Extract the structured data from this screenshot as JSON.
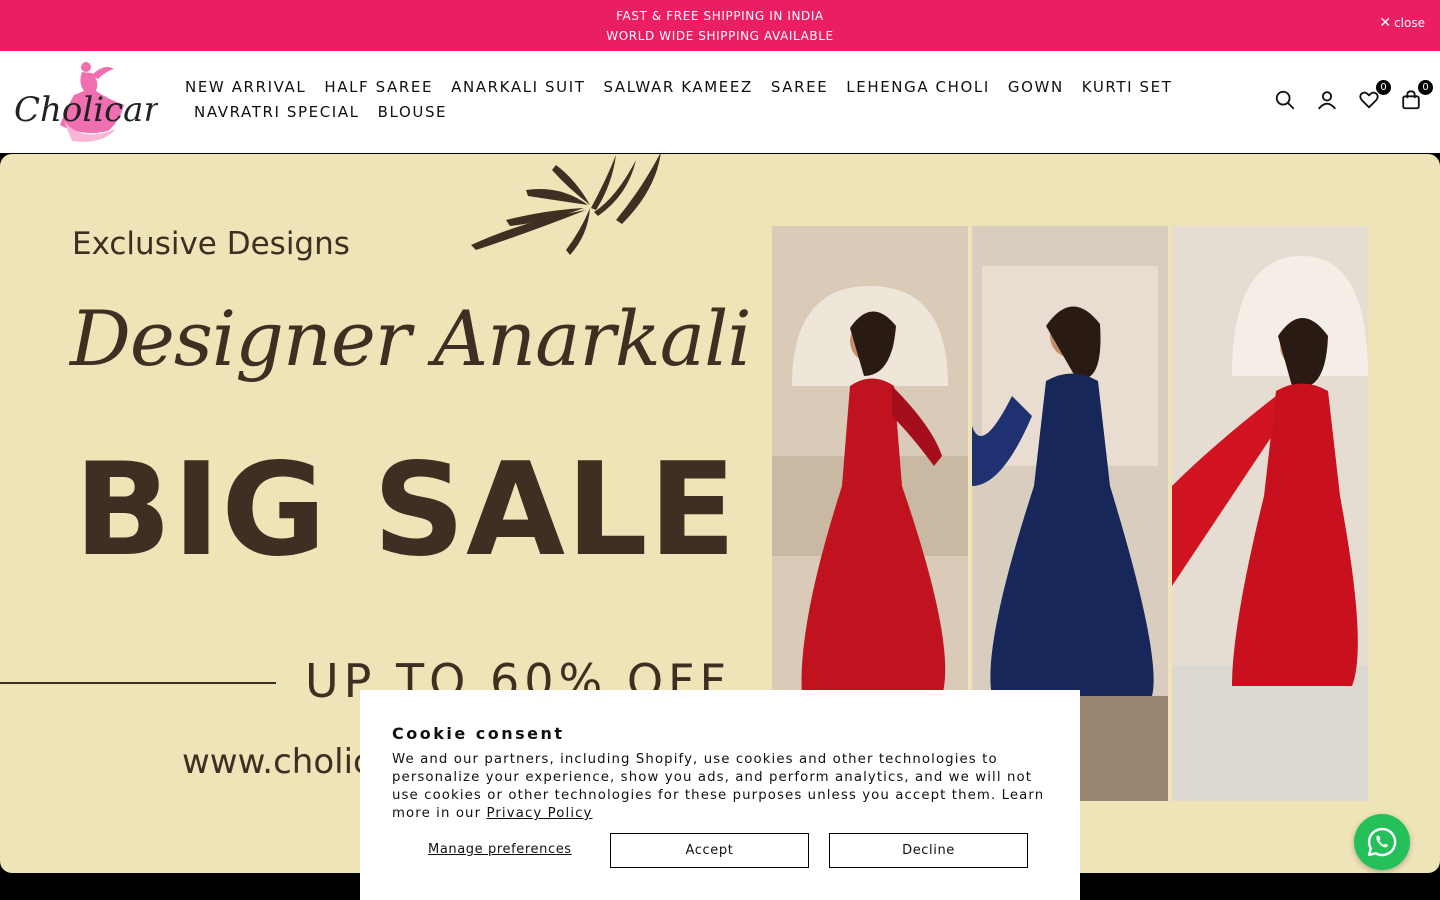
{
  "announcement": {
    "line1": "FAST & FREE SHIPPING IN INDIA",
    "line2": "WORLD WIDE SHIPPING AVAILABLE",
    "close_label": "close"
  },
  "header": {
    "logo_text": "Cholicart",
    "nav_row1": [
      "NEW ARRIVAL",
      "HALF SAREE",
      "ANARKALI SUIT",
      "SALWAR KAMEEZ",
      "SAREE",
      "LEHENGA CHOLI",
      "GOWN",
      "KURTI SET"
    ],
    "nav_row2": [
      "NAVRATRI SPECIAL",
      "BLOUSE"
    ],
    "icons": [
      "search-icon",
      "account-icon",
      "wishlist-icon",
      "cart-icon"
    ],
    "wishlist_count": "0",
    "cart_count": "0"
  },
  "hero": {
    "exclusive": "Exclusive Designs",
    "script_title": "Designer Anarkali Suits",
    "big_sale": "BIG SALE",
    "offer": "UP TO 60% OFF",
    "url": "www.cholic"
  },
  "cookie": {
    "title": "Cookie consent",
    "text": "We and our partners, including Shopify, use cookies and other technologies to personalize your experience, show you ads, and perform analytics, and we will not use cookies or other technologies for these purposes unless you accept them. Learn more in our ",
    "privacy_link": "Privacy Policy",
    "manage_label": "Manage preferences",
    "accept_label": "Accept",
    "decline_label": "Decline"
  },
  "colors": {
    "announce_bg": "#e91e63",
    "hero_bg": "#efe3b8",
    "hero_text": "#3d2f21",
    "whatsapp": "#25c05a"
  }
}
